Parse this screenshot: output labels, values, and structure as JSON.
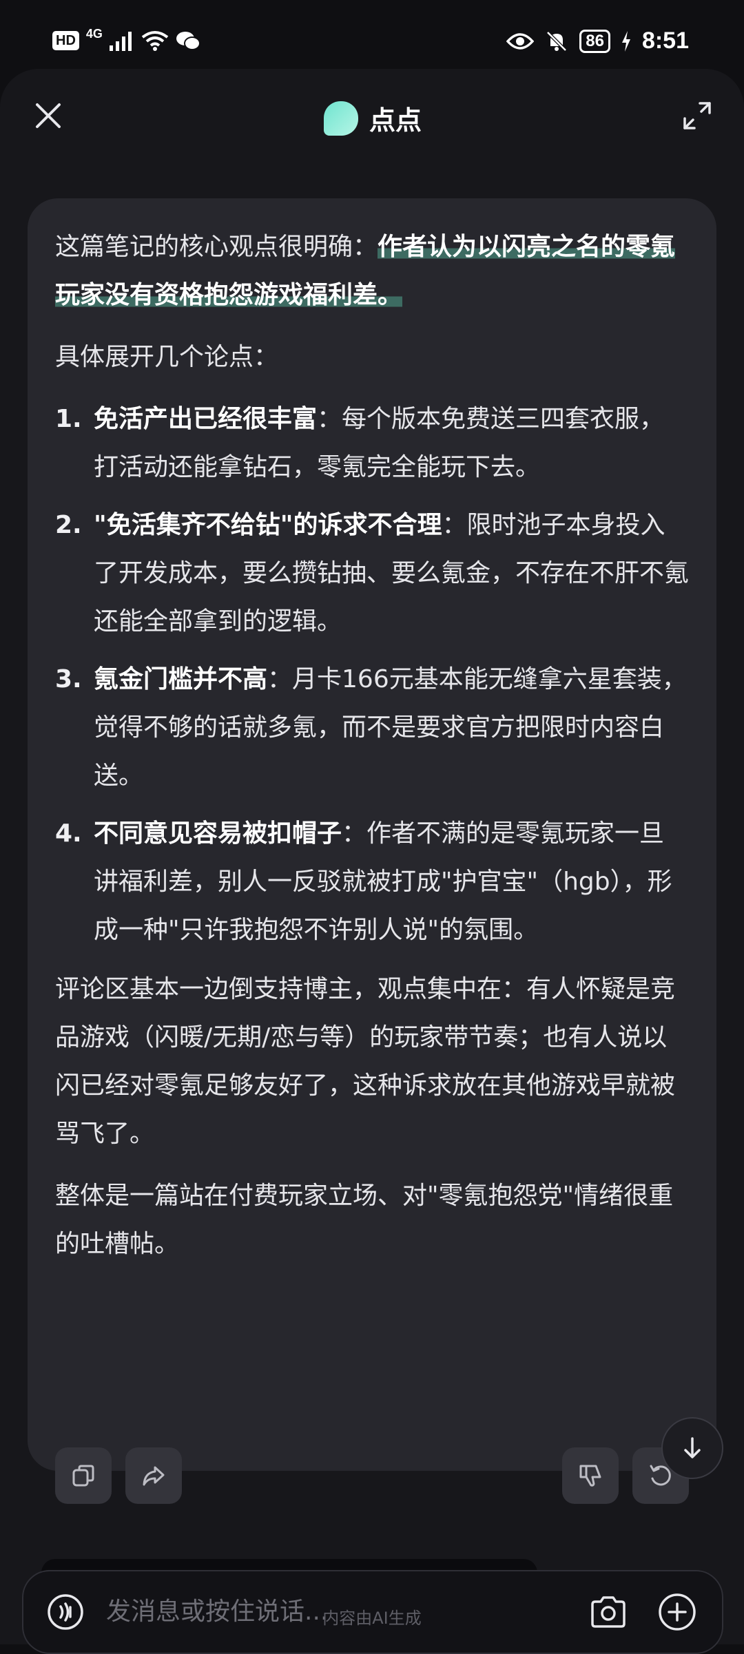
{
  "status_bar": {
    "hd": "HD",
    "network": "4G",
    "battery": "86",
    "time": "8:51"
  },
  "header": {
    "title": "点点",
    "logo_color": "#6fe4cf"
  },
  "message": {
    "intro_plain": "这篇笔记的核心观点很明确：",
    "intro_bold": "作者认为以闪亮之名的零氪玩家没有资格抱怨游戏福利差。",
    "sub_intro": "具体展开几个论点：",
    "points": [
      {
        "num": "1.",
        "bold": "免活产出已经很丰富",
        "text": "：每个版本免费送三四套衣服，打活动还能拿钻石，零氪完全能玩下去。"
      },
      {
        "num": "2.",
        "bold": "\"免活集齐不给钻\"的诉求不合理",
        "text": "：限时池子本身投入了开发成本，要么攒钻抽、要么氪金，不存在不肝不氪还能全部拿到的逻辑。"
      },
      {
        "num": "3.",
        "bold": "氪金门槛并不高",
        "text": "：月卡166元基本能无缝拿六星套装，觉得不够的话就多氪，而不是要求官方把限时内容白送。"
      },
      {
        "num": "4.",
        "bold": "不同意见容易被扣帽子",
        "text": "：作者不满的是零氪玩家一旦讲福利差，别人一反驳就被打成\"护官宝\"（hgb），形成一种\"只许我抱怨不许别人说\"的氛围。"
      }
    ],
    "comments": "评论区基本一边倒支持博主，观点集中在：有人怀疑是竞品游戏（闪暖/无期/恋与等）的玩家带节奏；也有人说以闪已经对零氪足够友好了，这种诉求放在其他游戏早就被骂飞了。",
    "conclusion": "整体是一篇站在付费玩家立场、对\"零氪抱怨党\"情绪很重的吐槽帖。"
  },
  "input": {
    "placeholder": "发消息或按住说话..."
  },
  "footnote": "内容由AI生成",
  "colors": {
    "background": "#17171b",
    "card": "#27272d",
    "highlight": "#3d6b62"
  }
}
